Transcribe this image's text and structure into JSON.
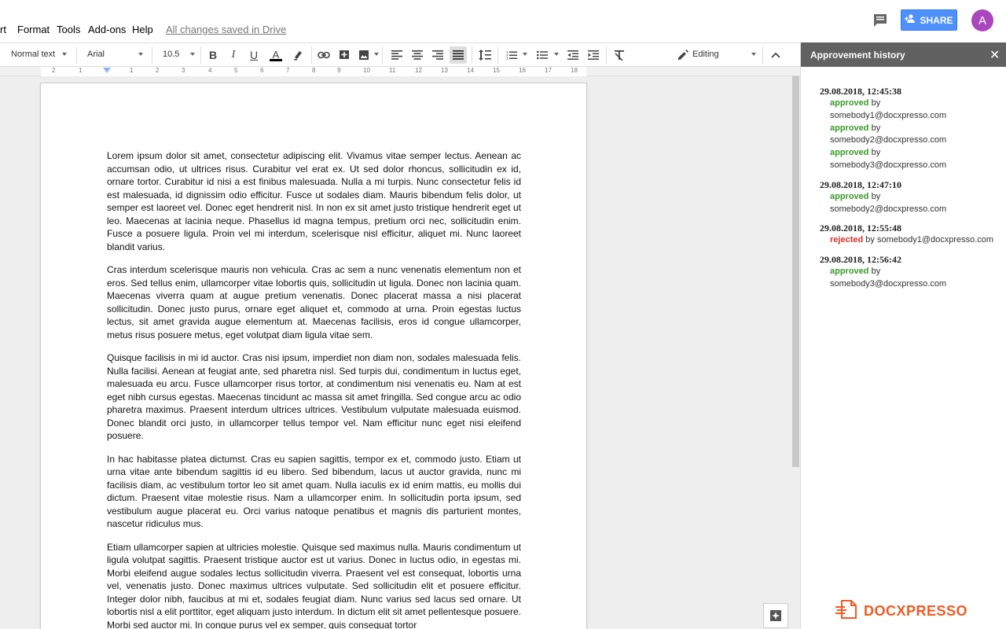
{
  "menu": {
    "items": [
      "rt",
      "Format",
      "Tools",
      "Add-ons",
      "Help"
    ],
    "saved_status": "All changes saved in Drive"
  },
  "header": {
    "share_label": "SHARE",
    "avatar_letter": "A"
  },
  "toolbar": {
    "style_value": "Normal text",
    "font_value": "Arial",
    "size_value": "10.5",
    "mode_value": "Editing"
  },
  "ruler": {
    "labels": [
      "2",
      "1",
      "1",
      "2",
      "3",
      "4",
      "5",
      "6",
      "7",
      "8",
      "9",
      "10",
      "11",
      "12",
      "13",
      "14",
      "15",
      "16",
      "17",
      "18"
    ]
  },
  "document": {
    "paragraphs": [
      "Lorem ipsum dolor sit amet, consectetur adipiscing elit. Vivamus vitae semper lectus. Aenean ac accumsan odio, ut ultrices risus. Curabitur vel erat ex. Ut sed dolor rhoncus, sollicitudin ex id, ornare tortor. Curabitur id nisi a est finibus malesuada. Nulla a mi turpis. Nunc consectetur felis id est malesuada, id dignissim odio efficitur. Fusce ut sodales diam. Mauris bibendum felis dolor, ut semper est laoreet vel. Donec eget hendrerit nisl. In non ex sit amet justo tristique hendrerit eget ut leo. Maecenas at lacinia neque. Phasellus id magna tempus, pretium orci nec, sollicitudin enim. Fusce a posuere ligula. Proin vel mi interdum, scelerisque nisl efficitur, aliquet mi. Nunc laoreet blandit varius.",
      "Cras interdum scelerisque mauris non vehicula. Cras ac sem a nunc venenatis elementum non et eros. Sed tellus enim, ullamcorper vitae lobortis quis, sollicitudin ut ligula. Donec non lacinia quam. Maecenas viverra quam at augue pretium venenatis. Donec placerat massa a nisi placerat sollicitudin. Donec justo purus, ornare eget aliquet et, commodo at urna. Proin egestas luctus lectus, sit amet gravida augue elementum at. Maecenas facilisis, eros id congue ullamcorper, metus risus posuere metus, eget volutpat diam ligula vitae sem.",
      "Quisque facilisis in mi id auctor. Cras nisi ipsum, imperdiet non diam non, sodales malesuada felis. Nulla facilisi. Aenean at feugiat ante, sed pharetra nisl. Sed turpis dui, condimentum in luctus eget, malesuada eu arcu. Fusce ullamcorper risus tortor, at condimentum nisi venenatis eu. Nam at est eget nibh cursus egestas. Maecenas tincidunt ac massa sit amet fringilla. Sed congue arcu ac odio pharetra maximus. Praesent interdum ultrices ultrices. Vestibulum vulputate malesuada euismod. Donec blandit orci justo, in ullamcorper tellus tempor vel. Nam efficitur nunc eget nisi eleifend posuere.",
      "In hac habitasse platea dictumst. Cras eu sapien sagittis, tempor ex et, commodo justo. Etiam ut urna vitae ante bibendum sagittis id eu libero. Sed bibendum, lacus ut auctor gravida, nunc mi facilisis diam, ac vestibulum tortor leo sit amet quam. Nulla iaculis ex id enim mattis, eu mollis dui dictum. Praesent vitae molestie risus. Nam a ullamcorper enim. In sollicitudin porta ipsum, sed vestibulum augue placerat eu. Orci varius natoque penatibus et magnis dis parturient montes, nascetur ridiculus mus.",
      "Etiam ullamcorper sapien at ultricies molestie. Quisque sed maximus nulla. Mauris condimentum ut ligula volutpat sagittis. Praesent tristique auctor est ut varius. Donec in luctus odio, in egestas mi. Morbi eleifend augue sodales lectus sollicitudin viverra. Praesent vel est consequat, lobortis urna vel, venenatis justo. Donec maximus ultrices vulputate. Sed sollicitudin elit et posuere efficitur. Integer dolor nibh, faucibus at mi et, sodales feugiat diam. Nunc varius sed lacus sed ornare. Ut lobortis nisl a elit porttitor, eget aliquam justo interdum. In dictum elit sit amet pellentesque posuere. Morbi sed auctor mi. In congue purus vel ex semper, quis consequat tortor"
    ]
  },
  "panel": {
    "title": "Approvement history",
    "entries": [
      {
        "date": "29.08.2018, 12:45:38",
        "actions": [
          {
            "status": "approved",
            "by": "by",
            "email": "somebody1@docxpresso.com"
          },
          {
            "status": "approved",
            "by": "by",
            "email": "somebody2@docxpresso.com"
          },
          {
            "status": "approved",
            "by": "by",
            "email": "somebody3@docxpresso.com"
          }
        ]
      },
      {
        "date": "29.08.2018, 12:47:10",
        "actions": [
          {
            "status": "approved",
            "by": "by",
            "email": "somebody2@docxpresso.com"
          }
        ]
      },
      {
        "date": "29.08.2018, 12:55:48",
        "actions": [
          {
            "status": "rejected",
            "by": "by",
            "email": "somebody1@docxpresso.com",
            "inline": true
          }
        ]
      },
      {
        "date": "29.08.2018, 12:56:42",
        "actions": [
          {
            "status": "approved",
            "by": "by",
            "email": "somebody3@docxpresso.com"
          }
        ]
      }
    ],
    "brand": "DOCXPRESSO"
  },
  "colors": {
    "approved": "#3a9a2a",
    "rejected": "#d93025",
    "brand": "#f15a24",
    "share": "#4d90fe",
    "avatar": "#ab47bc"
  }
}
